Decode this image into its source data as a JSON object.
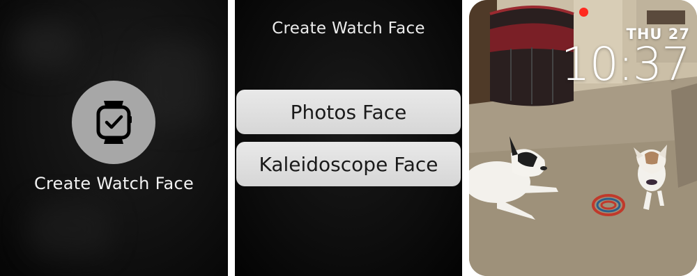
{
  "screen1": {
    "icon": "watch-icon",
    "button_label": "Create Watch Face"
  },
  "screen2": {
    "title": "Create Watch Face",
    "options": [
      {
        "label": "Photos Face"
      },
      {
        "label": "Kaleidoscope Face"
      }
    ]
  },
  "screen3": {
    "date": "THU 27",
    "time": "10:37",
    "recording_indicator_color": "#ff2a1f"
  }
}
